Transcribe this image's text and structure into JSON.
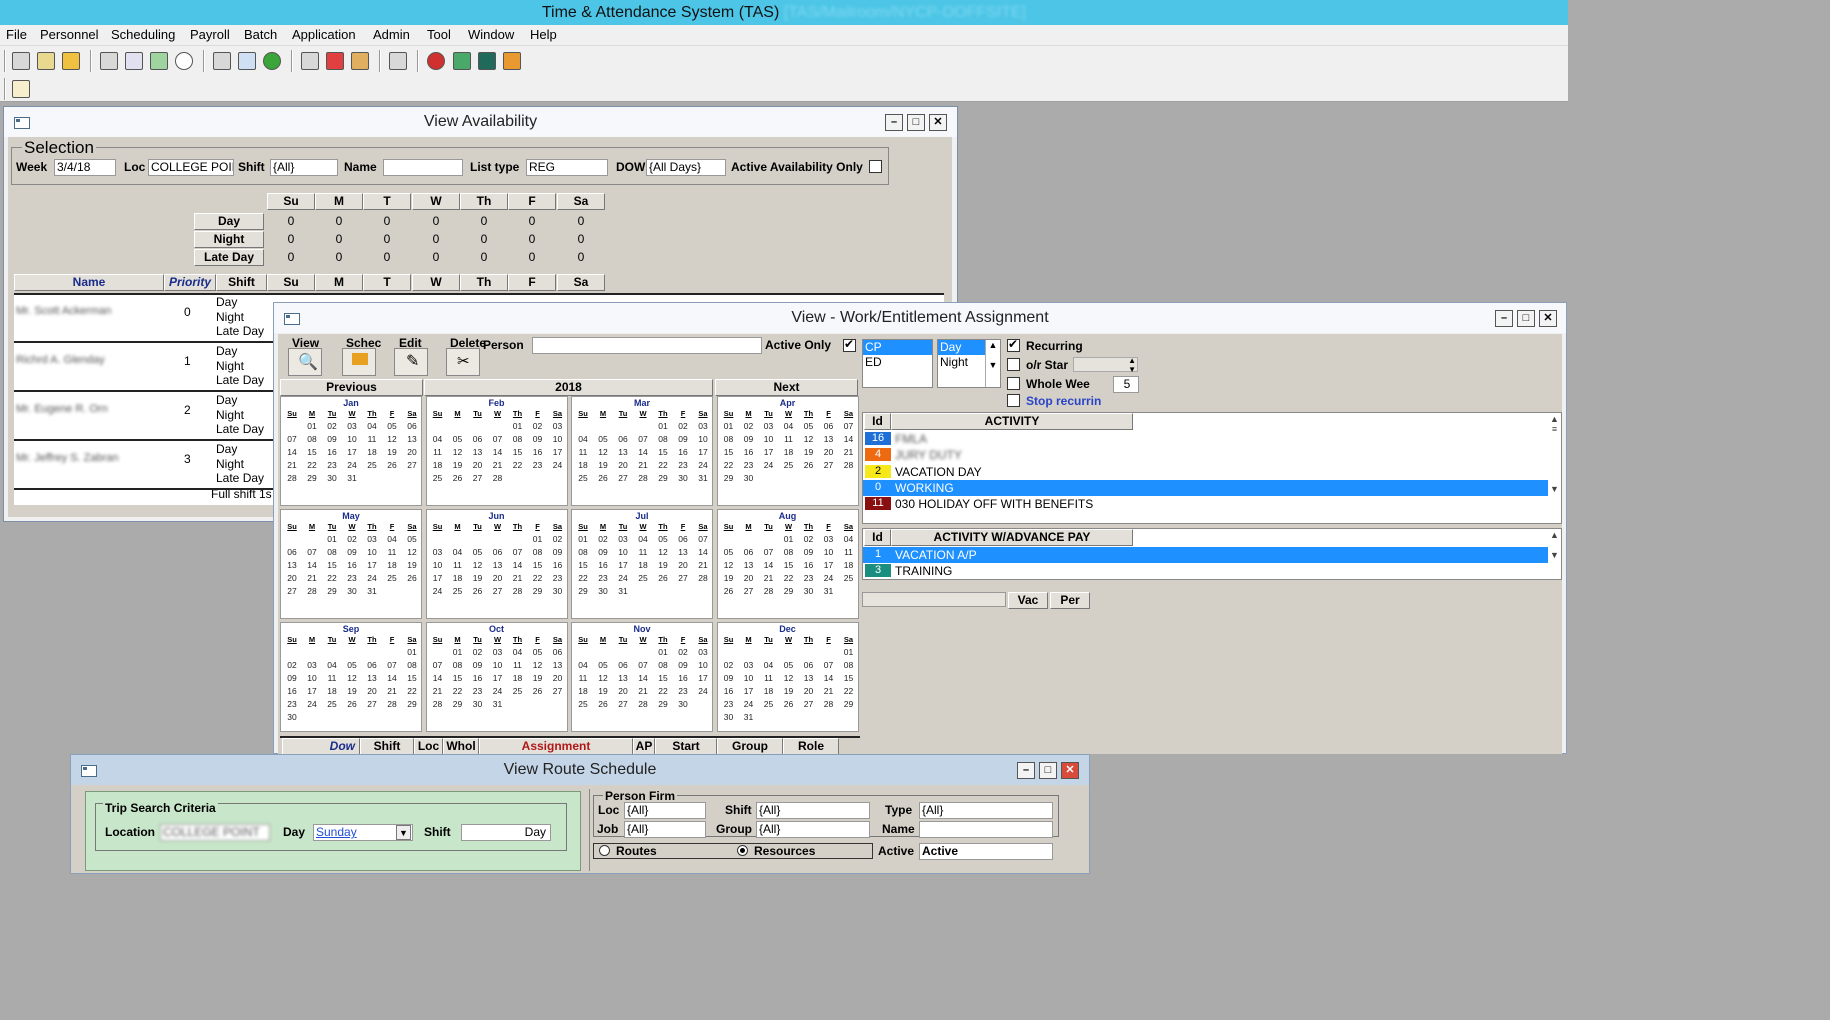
{
  "app": {
    "title": "Time & Attendance System (TAS)",
    "title_suffix": "[TAS/Mailroom/NYCP-DOFFSITE]"
  },
  "menu": [
    "File",
    "Personnel",
    "Scheduling",
    "Payroll",
    "Batch",
    "Application",
    "Admin",
    "Tool",
    "Window",
    "Help"
  ],
  "availability": {
    "title": "View Availability",
    "selection_label": "Selection",
    "week_label": "Week",
    "week_value": "3/4/18",
    "loc_label": "Loc",
    "loc_value": "COLLEGE POINT",
    "shift_label": "Shift",
    "shift_value": "{All}",
    "name_label": "Name",
    "name_value": "",
    "listtype_label": "List type",
    "listtype_value": "REG",
    "dow_label": "DOW",
    "dow_value": "{All Days}",
    "active_only_label": "Active Availability Only",
    "days": [
      "Su",
      "M",
      "T",
      "W",
      "Th",
      "F",
      "Sa"
    ],
    "summary_rows": [
      {
        "label": "Day",
        "values": [
          "0",
          "0",
          "0",
          "0",
          "0",
          "0",
          "0"
        ]
      },
      {
        "label": "Night",
        "values": [
          "0",
          "0",
          "0",
          "0",
          "0",
          "0",
          "0"
        ]
      },
      {
        "label": "Late Day",
        "values": [
          "0",
          "0",
          "0",
          "0",
          "0",
          "0",
          "0"
        ]
      }
    ],
    "columns": {
      "name": "Name",
      "priority": "Priority",
      "shift": "Shift"
    },
    "people": [
      {
        "name": "Mr. Scott Ackerman",
        "priority": "0",
        "shifts": [
          "Day",
          "Night",
          "Late Day"
        ]
      },
      {
        "name": "Richrd A. Glenday",
        "priority": "1",
        "shifts": [
          "Day",
          "Night",
          "Late Day"
        ]
      },
      {
        "name": "Mr. Eugene R. Orn",
        "priority": "2",
        "shifts": [
          "Day",
          "Night",
          "Late Day"
        ]
      },
      {
        "name": "Mr. Jeffrey S. Zabran",
        "priority": "3",
        "shifts": [
          "Day",
          "Night",
          "Late Day"
        ]
      }
    ],
    "footer_text": "Full shift 1s"
  },
  "work": {
    "title": "View - Work/Entitlement Assignment",
    "toolbar": {
      "view": "View",
      "sched": "Schec",
      "edit": "Edit",
      "delete": "Delete"
    },
    "person_label": "Person",
    "person_value": "",
    "active_only_label": "Active Only",
    "nav": {
      "prev": "Previous",
      "year": "2018",
      "next": "Next"
    },
    "months": [
      {
        "name": "Jan",
        "offset": 1,
        "days": 31
      },
      {
        "name": "Feb",
        "offset": 4,
        "days": 28
      },
      {
        "name": "Mar",
        "offset": 4,
        "days": 31
      },
      {
        "name": "Apr",
        "offset": 0,
        "days": 30
      },
      {
        "name": "May",
        "offset": 2,
        "days": 31
      },
      {
        "name": "Jun",
        "offset": 5,
        "days": 30
      },
      {
        "name": "Jul",
        "offset": 0,
        "days": 31
      },
      {
        "name": "Aug",
        "offset": 3,
        "days": 31
      },
      {
        "name": "Sep",
        "offset": 6,
        "days": 30
      },
      {
        "name": "Oct",
        "offset": 1,
        "days": 31
      },
      {
        "name": "Nov",
        "offset": 4,
        "days": 30
      },
      {
        "name": "Dec",
        "offset": 6,
        "days": 31
      }
    ],
    "day_headers": [
      "Su",
      "M",
      "Tu",
      "W",
      "Th",
      "F",
      "Sa"
    ],
    "loc_list": [
      "CP",
      "ED"
    ],
    "shift_list": [
      "Day",
      "Night"
    ],
    "recurring_label": "Recurring",
    "or_start_label": "o/r Star",
    "whole_week_label": "Whole Wee",
    "whole_week_value": "5",
    "stop_recurring_label": "Stop recurrin",
    "activity_header": {
      "id": "Id",
      "name": "ACTIVITY"
    },
    "activities": [
      {
        "id": "16",
        "name": "FMLA",
        "color": "#1f6fd6",
        "blur": true
      },
      {
        "id": "4",
        "name": "JURY DUTY",
        "color": "#ee6a10",
        "blur": true
      },
      {
        "id": "2",
        "name": "VACATION DAY",
        "color": "#f6e81a",
        "blur": false
      },
      {
        "id": "0",
        "name": "WORKING",
        "color": "#1e90ff",
        "blur": false
      },
      {
        "id": "11",
        "name": "030 HOLIDAY OFF WITH BENEFITS",
        "color": "#8a1010",
        "blur": false
      }
    ],
    "advance_header": {
      "id": "Id",
      "name": "ACTIVITY W/ADVANCE PAY"
    },
    "advance": [
      {
        "id": "1",
        "name": "VACATION A/P",
        "color": "#1e90ff"
      },
      {
        "id": "3",
        "name": "TRAINING",
        "color": "#1a8f80"
      }
    ],
    "vac_label": "Vac",
    "per_label": "Per",
    "tabs": [
      "Dow",
      "Shift",
      "Loc",
      "Whol",
      "Assignment",
      "AP",
      "Start",
      "Group",
      "Role"
    ]
  },
  "route": {
    "title": "View Route Schedule",
    "trip_label": "Trip Search Criteria",
    "location_label": "Location",
    "location_value": "COLLEGE POINT",
    "day_label": "Day",
    "day_value": "Sunday",
    "shift_label": "Shift",
    "shift_value": "Day",
    "person_firm_label": "Person Firm",
    "loc_label": "Loc",
    "loc_value": "{All}",
    "shift2_label": "Shift",
    "shift2_value": "{All}",
    "type_label": "Type",
    "type_value": "{All}",
    "job_label": "Job",
    "job_value": "{All}",
    "group_label": "Group",
    "group_value": "{All}",
    "name_label": "Name",
    "name_value": "",
    "routes_label": "Routes",
    "resources_label": "Resources",
    "active_label": "Active",
    "active_value": "Active"
  }
}
